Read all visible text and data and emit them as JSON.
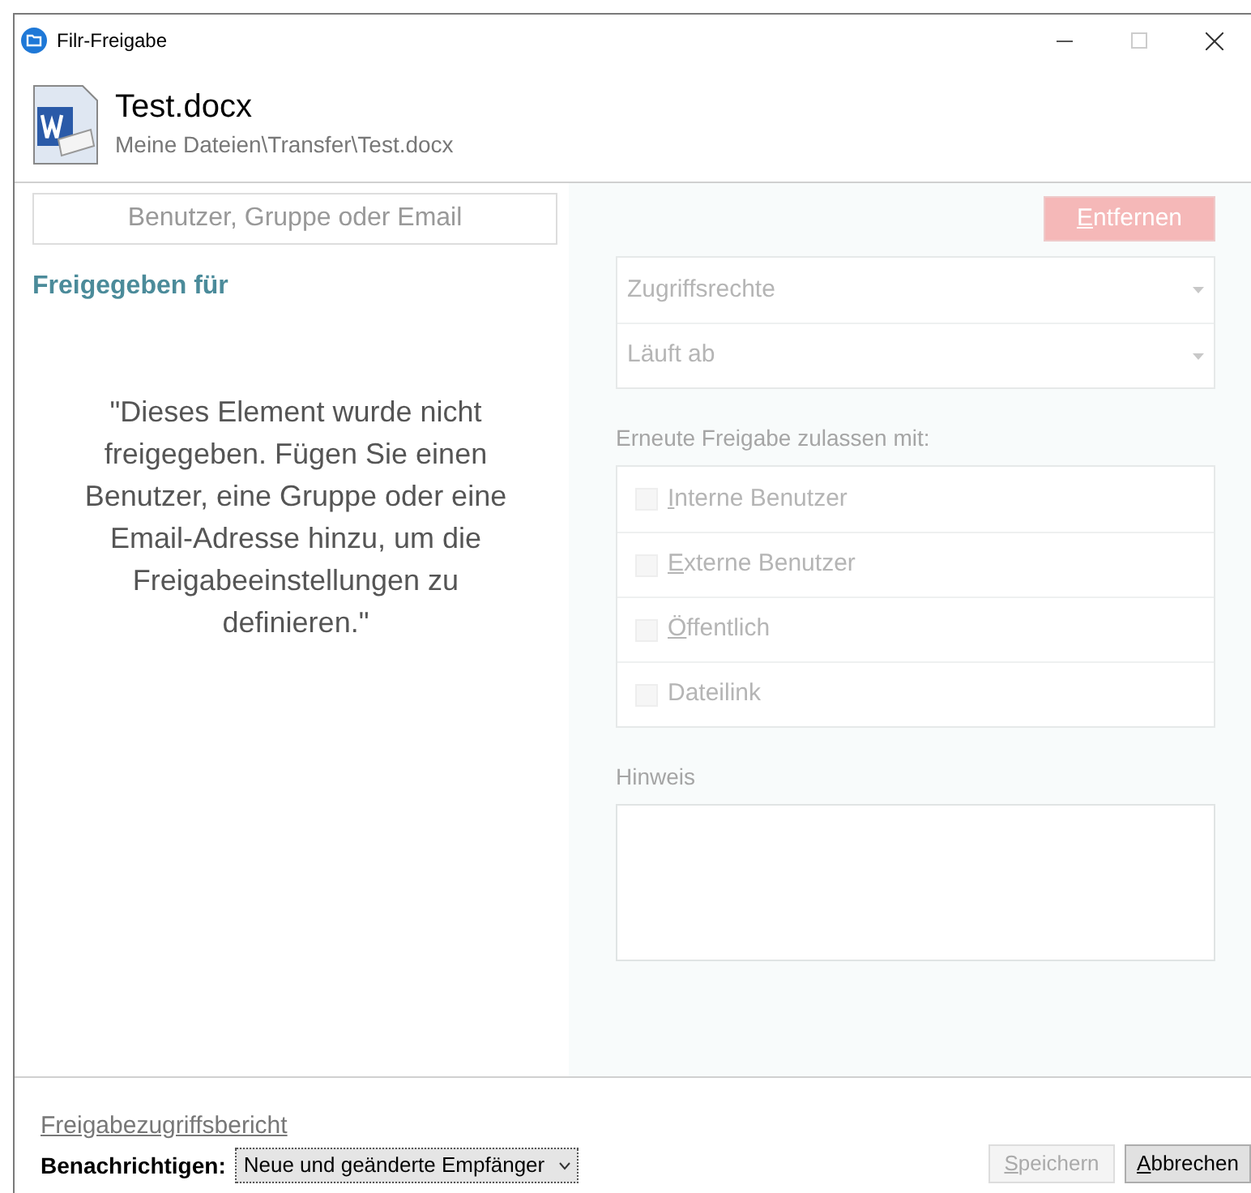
{
  "window": {
    "title": "Filr-Freigabe"
  },
  "file": {
    "name": "Test.docx",
    "path": "Meine Dateien\\Transfer\\Test.docx"
  },
  "search": {
    "placeholder": "Benutzer, Gruppe oder Email"
  },
  "shared_with": {
    "heading": "Freigegeben für",
    "message": "\"Dieses Element wurde nicht freigegeben. Fügen Sie einen Benutzer, eine Gruppe oder eine Email-Adresse hinzu, um die Freigabeeinstellungen zu definieren.\""
  },
  "remove_button": {
    "label": "Entfernen",
    "underline_first": true,
    "disabled": true
  },
  "dropdowns": [
    {
      "label": "Zugriffsrechte",
      "disabled": true
    },
    {
      "label": "Läuft ab",
      "disabled": true
    }
  ],
  "reshare": {
    "heading": "Erneute Freigabe zulassen mit:",
    "options": [
      {
        "label": "Interne Benutzer",
        "underline_first": true,
        "checked": false,
        "disabled": true
      },
      {
        "label": "Externe Benutzer",
        "underline_first": true,
        "checked": false,
        "disabled": true
      },
      {
        "label": "Öffentlich",
        "underline_first": true,
        "checked": false,
        "disabled": true
      },
      {
        "label": "Dateilink",
        "underline_first": false,
        "checked": false,
        "disabled": true
      }
    ]
  },
  "note": {
    "label": "Hinweis",
    "disabled": true
  },
  "footer": {
    "report_link": "Freigabezugriffsbericht",
    "notify_label": "Benachrichtigen:",
    "notify_value": "Neue und geänderte Empfänger",
    "buttons": [
      {
        "label": "Speichern",
        "underline_first": true,
        "disabled": true
      },
      {
        "label": "Abbrechen",
        "underline_first": true,
        "disabled": false
      }
    ]
  }
}
